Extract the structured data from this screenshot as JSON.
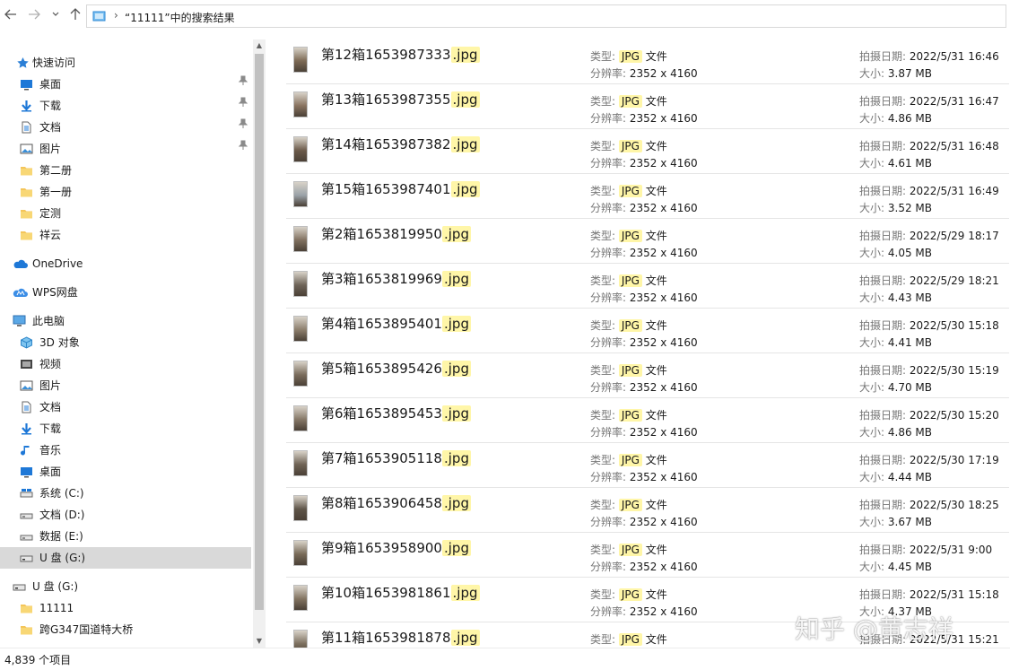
{
  "address": {
    "crumb": "“11111”中的搜索结果",
    "sep": "›",
    "back_icon": "arrow-left",
    "forward_icon": "arrow-right",
    "recent_icon": "chevron-down",
    "up_icon": "arrow-up"
  },
  "nav": {
    "quick_access": "快速访问",
    "quick_items": [
      {
        "label": "桌面",
        "icon": "desktop-icon",
        "pinned": true
      },
      {
        "label": "下载",
        "icon": "download-icon",
        "pinned": true
      },
      {
        "label": "文档",
        "icon": "document-icon",
        "pinned": true
      },
      {
        "label": "图片",
        "icon": "pictures-icon",
        "pinned": true
      },
      {
        "label": "第二册",
        "icon": "folder-icon",
        "pinned": false
      },
      {
        "label": "第一册",
        "icon": "folder-icon",
        "pinned": false
      },
      {
        "label": "定测",
        "icon": "folder-icon",
        "pinned": false
      },
      {
        "label": "祥云",
        "icon": "folder-icon",
        "pinned": false
      }
    ],
    "onedrive": "OneDrive",
    "wps": "WPS网盘",
    "this_pc": "此电脑",
    "pc_items": [
      {
        "label": "3D 对象",
        "icon": "3d-objects-icon"
      },
      {
        "label": "视频",
        "icon": "video-icon"
      },
      {
        "label": "图片",
        "icon": "pictures-icon"
      },
      {
        "label": "文档",
        "icon": "document-icon"
      },
      {
        "label": "下载",
        "icon": "download-icon"
      },
      {
        "label": "音乐",
        "icon": "music-icon"
      },
      {
        "label": "桌面",
        "icon": "desktop-icon"
      },
      {
        "label": "系统 (C:)",
        "icon": "drive-c-icon"
      },
      {
        "label": "文档 (D:)",
        "icon": "drive-icon"
      },
      {
        "label": "数据 (E:)",
        "icon": "drive-icon"
      },
      {
        "label": "U 盘 (G:)",
        "icon": "usb-drive-icon",
        "selected": true
      }
    ],
    "usb_root": "U 盘 (G:)",
    "usb_items": [
      {
        "label": "11111",
        "icon": "folder-icon"
      },
      {
        "label": "跨G347国道特大桥",
        "icon": "folder-icon"
      }
    ]
  },
  "labels": {
    "type": "类型:",
    "res": "分辨率:",
    "date": "拍摄日期:",
    "size": "大小:",
    "ext": ".jpg",
    "type_tag": "JPG",
    "type_suffix": " 文件"
  },
  "files": [
    {
      "name": "第12箱1653987333",
      "res": "2352 x 4160",
      "date": "2022/5/31 16:46",
      "size": "3.87 MB"
    },
    {
      "name": "第13箱1653987355",
      "res": "2352 x 4160",
      "date": "2022/5/31 16:47",
      "size": "4.86 MB"
    },
    {
      "name": "第14箱1653987382",
      "res": "2352 x 4160",
      "date": "2022/5/31 16:48",
      "size": "4.61 MB"
    },
    {
      "name": "第15箱1653987401",
      "res": "2352 x 4160",
      "date": "2022/5/31 16:49",
      "size": "3.52 MB"
    },
    {
      "name": "第2箱1653819950",
      "res": "2352 x 4160",
      "date": "2022/5/29 18:17",
      "size": "4.05 MB"
    },
    {
      "name": "第3箱1653819969",
      "res": "2352 x 4160",
      "date": "2022/5/29 18:21",
      "size": "4.43 MB"
    },
    {
      "name": "第4箱1653895401",
      "res": "2352 x 4160",
      "date": "2022/5/30 15:18",
      "size": "4.41 MB"
    },
    {
      "name": "第5箱1653895426",
      "res": "2352 x 4160",
      "date": "2022/5/30 15:19",
      "size": "4.70 MB"
    },
    {
      "name": "第6箱1653895453",
      "res": "2352 x 4160",
      "date": "2022/5/30 15:20",
      "size": "4.86 MB"
    },
    {
      "name": "第7箱1653905118",
      "res": "2352 x 4160",
      "date": "2022/5/30 17:19",
      "size": "4.44 MB"
    },
    {
      "name": "第8箱1653906458",
      "res": "2352 x 4160",
      "date": "2022/5/30 18:25",
      "size": "3.67 MB"
    },
    {
      "name": "第9箱1653958900",
      "res": "2352 x 4160",
      "date": "2022/5/31 9:00",
      "size": "4.45 MB"
    },
    {
      "name": "第10箱1653981861",
      "res": "2352 x 4160",
      "date": "2022/5/31 15:18",
      "size": "4.37 MB"
    },
    {
      "name": "第11箱1653981878",
      "res": "",
      "date": "2022/5/31 15:21",
      "size": ""
    }
  ],
  "status": {
    "count": "4,839 个项目"
  },
  "watermark": "知乎 @黄志祥",
  "colors": {
    "highlight": "#fff6a8",
    "selection": "#d9d9d9",
    "folder": "#f4c55a",
    "accent": "#1e78d7"
  }
}
